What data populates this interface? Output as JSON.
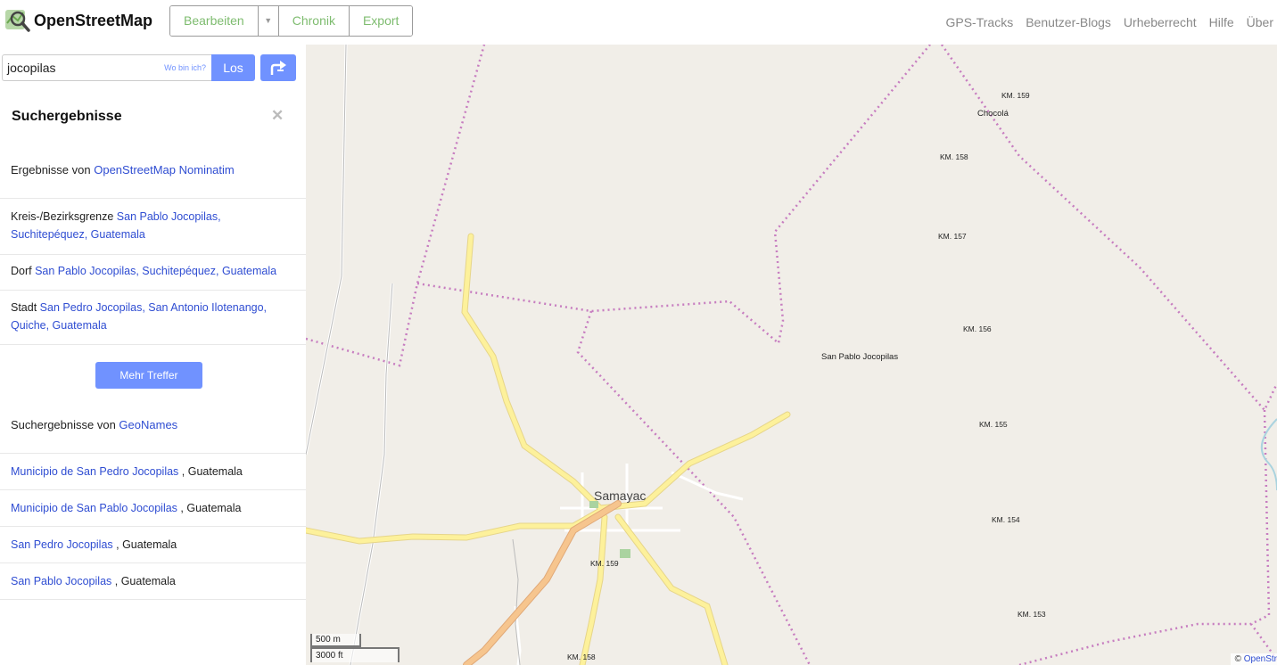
{
  "header": {
    "brand": "OpenStreetMap",
    "primary_buttons": [
      {
        "label": "Bearbeiten"
      },
      {
        "label": "Chronik"
      },
      {
        "label": "Export"
      }
    ],
    "secondary_links": [
      "GPS-Tracks",
      "Benutzer-Blogs",
      "Urheberrecht",
      "Hilfe",
      "Über"
    ],
    "accent_color": "#7ebc6f"
  },
  "search": {
    "value": "jocopilas",
    "where_am_i": "Wo bin ich?",
    "go_label": "Los",
    "button_color": "#7092ff"
  },
  "sidebar": {
    "title": "Suchergebnisse",
    "nominatim": {
      "prefix": "Ergebnisse von ",
      "source": "OpenStreetMap Nominatim",
      "results": [
        {
          "type": "Kreis-/Bezirksgrenze ",
          "name_line1": "San Pablo Jocopilas,",
          "name_line2": "Suchitepéquez, Guatemala"
        },
        {
          "type": "Dorf ",
          "name": "San Pablo Jocopilas, Suchitepéquez, Guatemala"
        },
        {
          "type": "Stadt ",
          "name_line1": "San Pedro Jocopilas, San Antonio Ilotenango,",
          "name_line2": "Quiche, Guatemala"
        }
      ]
    },
    "more_results": "Mehr Treffer",
    "geonames": {
      "prefix": "Suchergebnisse von ",
      "source": "GeoNames",
      "results": [
        {
          "name": "Municipio de San Pedro Jocopilas",
          "suffix": " , Guatemala"
        },
        {
          "name": "Municipio de San Pablo Jocopilas",
          "suffix": " , Guatemala"
        },
        {
          "name": "San Pedro Jocopilas",
          "suffix": " , Guatemala"
        },
        {
          "name": "San Pablo Jocopilas",
          "suffix": " , Guatemala"
        }
      ]
    }
  },
  "map": {
    "labels": {
      "km159_top": "KM. 159",
      "chocola": "Chocolá",
      "km158_top": "KM. 158",
      "km157": "KM. 157",
      "km156": "KM. 156",
      "san_pablo": "San Pablo Jocopilas",
      "km155": "KM. 155",
      "samayac": "Samayac",
      "km154": "KM. 154",
      "km159_bottom": "KM. 159",
      "km153": "KM. 153",
      "km158_bottom": "KM. 158"
    },
    "scale": {
      "metric": "500 m",
      "imperial": "3000 ft"
    },
    "attribution": "OpenStr",
    "attribution_prefix": "© ",
    "background_color": "#f1eee8",
    "boundary_color": "#c77dc0",
    "road_color": "#fdf19b"
  }
}
